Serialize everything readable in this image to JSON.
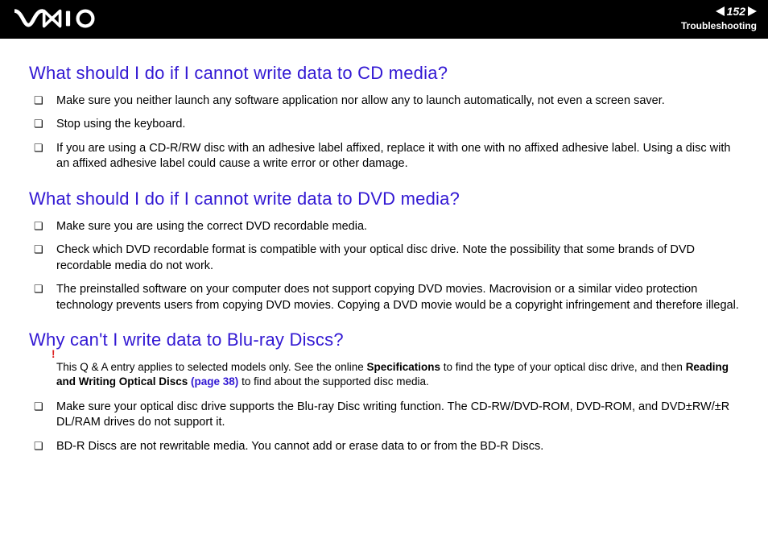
{
  "header": {
    "page_number": "152",
    "section": "Troubleshooting"
  },
  "sections": [
    {
      "heading": "What should I do if I cannot write data to CD media?",
      "items": [
        "Make sure you neither launch any software application nor allow any to launch automatically, not even a screen saver.",
        "Stop using the keyboard.",
        "If you are using a CD-R/RW disc with an adhesive label affixed, replace it with one with no affixed adhesive label. Using a disc with an affixed adhesive label could cause a write error or other damage."
      ]
    },
    {
      "heading": "What should I do if I cannot write data to DVD media?",
      "items": [
        "Make sure you are using the correct DVD recordable media.",
        "Check which DVD recordable format is compatible with your optical disc drive. Note the possibility that some brands of DVD recordable media do not work.",
        "The preinstalled software on your computer does not support copying DVD movies. Macrovision or a similar video protection technology prevents users from copying DVD movies. Copying a DVD movie would be a copyright infringement and therefore illegal."
      ]
    },
    {
      "heading": "Why can't I write data to Blu-ray Discs?",
      "note": {
        "pre": "This Q & A entry applies to selected models only. See the online ",
        "bold1": "Specifications",
        "mid1": " to find the type of your optical disc drive, and then ",
        "bold2": "Reading and Writing Optical Discs ",
        "link": "(page 38)",
        "post": " to find about the supported disc media."
      },
      "items": [
        "Make sure your optical disc drive supports the Blu-ray Disc writing function. The CD-RW/DVD-ROM, DVD-ROM, and DVD±RW/±R DL/RAM drives do not support it.",
        "BD-R Discs are not rewritable media. You cannot add or erase data to or from the BD-R Discs."
      ]
    }
  ]
}
